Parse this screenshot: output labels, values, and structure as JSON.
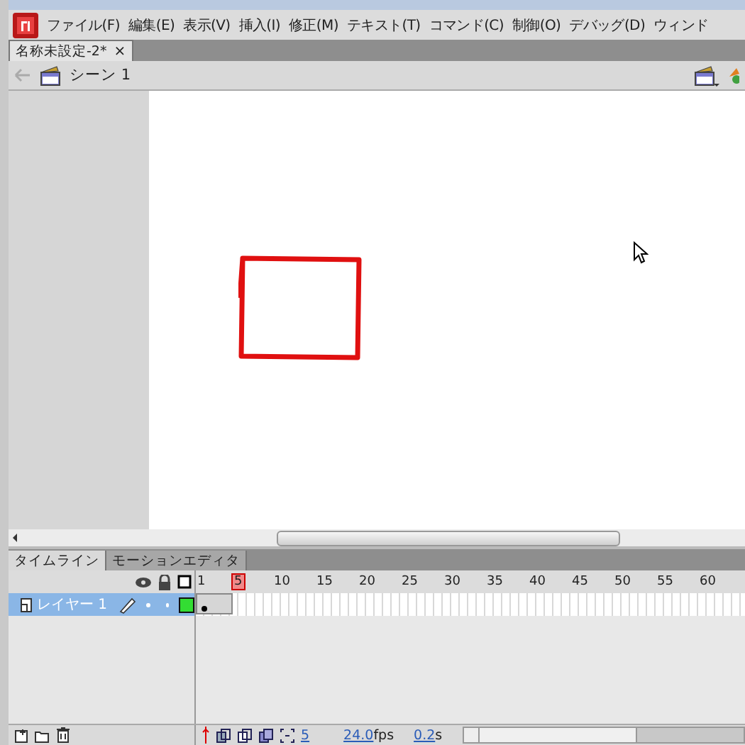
{
  "menu": [
    "ファイル(F)",
    "編集(E)",
    "表示(V)",
    "挿入(I)",
    "修正(M)",
    "テキスト(T)",
    "コマンド(C)",
    "制御(O)",
    "デバッグ(D)",
    "ウィンド"
  ],
  "document_tabs": [
    {
      "label": "名称未設定-2*",
      "close": "×",
      "selected": true
    }
  ],
  "edit_bar": {
    "scene": "シーン 1"
  },
  "timeline_tabs": [
    {
      "label": "タイムライン",
      "selected": true
    },
    {
      "label": "モーションエディタ",
      "selected": false
    }
  ],
  "ruler": [
    {
      "label": "1",
      "selected": false
    },
    {
      "label": "5",
      "selected": true
    },
    {
      "label": "10",
      "selected": false
    },
    {
      "label": "15",
      "selected": false
    },
    {
      "label": "20",
      "selected": false
    },
    {
      "label": "25",
      "selected": false
    },
    {
      "label": "30",
      "selected": false
    },
    {
      "label": "35",
      "selected": false
    },
    {
      "label": "40",
      "selected": false
    },
    {
      "label": "45",
      "selected": false
    },
    {
      "label": "50",
      "selected": false
    },
    {
      "label": "55",
      "selected": false
    },
    {
      "label": "60",
      "selected": false
    }
  ],
  "layers": [
    {
      "name": "レイヤー 1",
      "selected": true
    }
  ],
  "status_bar": {
    "current_frame": "5",
    "frame_rate": "24.0",
    "frame_rate_unit": "fps",
    "elapsed": "0.2",
    "elapsed_unit": "s"
  }
}
